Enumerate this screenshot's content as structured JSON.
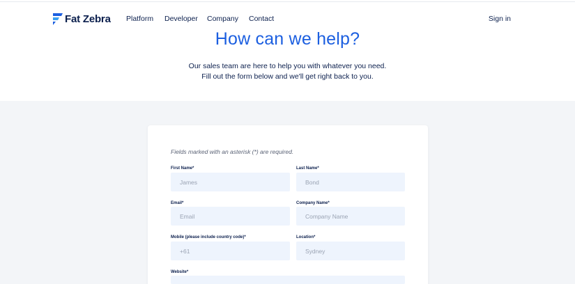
{
  "header": {
    "logo_text": "Fat Zebra",
    "nav": [
      {
        "label": "Platform"
      },
      {
        "label": "Developer"
      },
      {
        "label": "Company"
      },
      {
        "label": "Contact"
      }
    ],
    "signin_label": "Sign in"
  },
  "hero": {
    "title": "How can we help?",
    "subtitle_line1": "Our sales team are here to help you with whatever you need.",
    "subtitle_line2": "Fill out the form below and we'll get right back to you."
  },
  "form": {
    "note": "Fields marked with an asterisk (*) are required.",
    "fields": {
      "first_name": {
        "label": "First Name*",
        "placeholder": "James"
      },
      "last_name": {
        "label": "Last Name*",
        "placeholder": "Bond"
      },
      "email": {
        "label": "Email*",
        "placeholder": "Email"
      },
      "company": {
        "label": "Company Name*",
        "placeholder": "Company Name"
      },
      "mobile": {
        "label": "Mobile (please include country code)*",
        "placeholder": "+61"
      },
      "location": {
        "label": "Location*",
        "placeholder": "Sydney"
      },
      "website": {
        "label": "Website*",
        "placeholder": ""
      }
    }
  },
  "colors": {
    "brand_blue": "#1c5fe0",
    "navy": "#0b1f4d",
    "input_bg": "#eef4fd",
    "band_bg": "#f3f5f8"
  },
  "icons": {
    "logo": "fat-zebra-logo-icon"
  }
}
